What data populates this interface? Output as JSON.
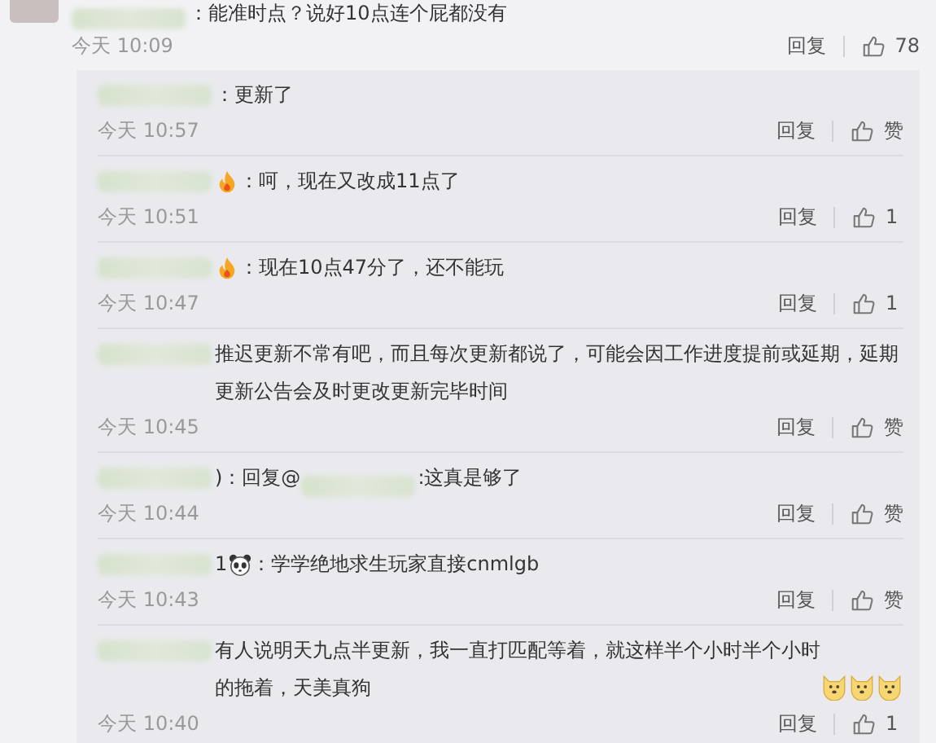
{
  "top_comment": {
    "parts": [
      {
        "kind": "blur"
      },
      {
        "kind": "text",
        "text": "：能准时点？说好10点连个屁都没有"
      }
    ],
    "time": "今天 10:09",
    "reply": "回复",
    "likes": "78"
  },
  "replies": [
    {
      "parts": [
        {
          "kind": "blur"
        },
        {
          "kind": "text",
          "text": "：更新了"
        }
      ],
      "time": "今天 10:57",
      "reply": "回复",
      "likes": "赞"
    },
    {
      "parts": [
        {
          "kind": "blur"
        },
        {
          "kind": "badge"
        },
        {
          "kind": "text",
          "text": "：呵，现在又改成11点了"
        }
      ],
      "time": "今天 10:51",
      "reply": "回复",
      "likes": "1"
    },
    {
      "parts": [
        {
          "kind": "blur"
        },
        {
          "kind": "badge"
        },
        {
          "kind": "text",
          "text": "：现在10点47分了，还不能玩"
        }
      ],
      "time": "今天 10:47",
      "reply": "回复",
      "likes": "1"
    },
    {
      "parts": [
        {
          "kind": "blur"
        },
        {
          "kind": "text",
          "text": " 推迟更新不常有吧，而且每次更新都说了，可能会因工作进度提前或延期，延期更新公告会及时更改更新完毕时间"
        }
      ],
      "time": "今天 10:45",
      "reply": "回复",
      "likes": "赞"
    },
    {
      "parts": [
        {
          "kind": "blur"
        },
        {
          "kind": "text",
          "text": ")：回复@"
        },
        {
          "kind": "blur"
        },
        {
          "kind": "text",
          "text": ":这真是够了"
        }
      ],
      "time": "今天 10:44",
      "reply": "回复",
      "likes": "赞"
    },
    {
      "parts": [
        {
          "kind": "blur"
        },
        {
          "kind": "text",
          "text": "1"
        },
        {
          "kind": "panda"
        },
        {
          "kind": "text",
          "text": "：学学绝地求生玩家直接cnmlgb"
        }
      ],
      "time": "今天 10:43",
      "reply": "回复",
      "likes": "赞"
    },
    {
      "parts": [
        {
          "kind": "blur"
        },
        {
          "kind": "text",
          "text": " 有人说明天九点半更新，我一直打匹配等着，就这样半个小时半个小时的拖着，天美真狗"
        },
        {
          "kind": "dog"
        },
        {
          "kind": "dog"
        },
        {
          "kind": "dog"
        }
      ],
      "time": "今天 10:40",
      "reply": "回复",
      "likes": "1"
    }
  ]
}
